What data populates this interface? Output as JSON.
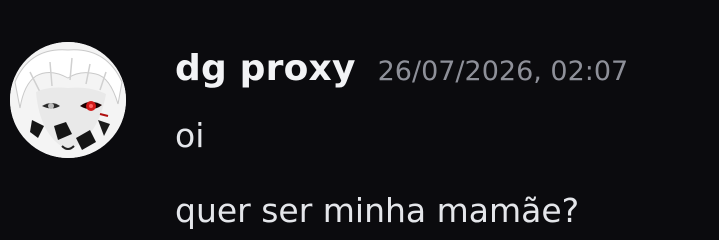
{
  "message": {
    "author": "dg proxy",
    "timestamp": "26/07/2026, 02:07",
    "avatar_icon": "anime-avatar-icon",
    "lines": [
      "oi",
      "quer ser minha mamãe?"
    ]
  },
  "colors": {
    "background": "#0b0b0e",
    "author": "#f2f3f5",
    "timestamp": "#8e9099",
    "text": "#e4e6ea"
  }
}
